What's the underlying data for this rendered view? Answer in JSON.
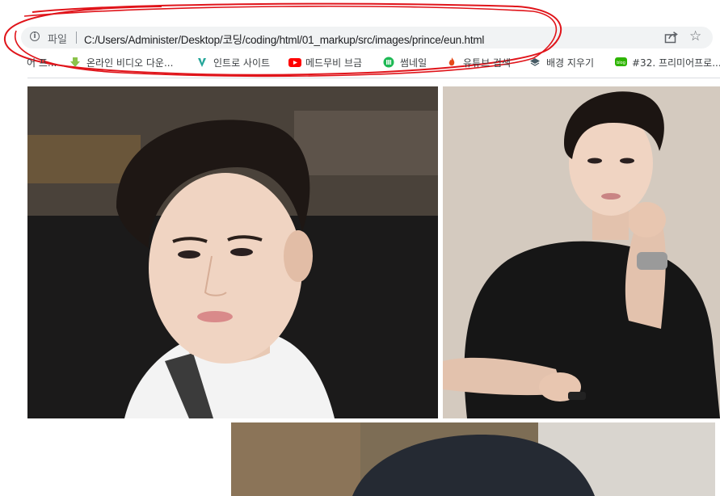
{
  "omnibox": {
    "scheme_label": "파일",
    "url": "C:/Users/Administer/Desktop/코딩/coding/html/01_markup/src/images/prince/eun.html",
    "info_icon": "info-icon",
    "share_icon": "share-icon",
    "star_icon": "star-icon"
  },
  "bookmarks": {
    "items": [
      {
        "label": "어 프...",
        "icon": "none"
      },
      {
        "label": "온라인 비디오 다운...",
        "icon": "download-arrow-icon"
      },
      {
        "label": "인트로 사이트",
        "icon": "v-logo-icon"
      },
      {
        "label": "메드무비 브금",
        "icon": "youtube-icon"
      },
      {
        "label": "썸네일",
        "icon": "green-circle-icon"
      },
      {
        "label": "유튜브 검색",
        "icon": "flame-icon"
      },
      {
        "label": "배경 지우기",
        "icon": "layers-icon"
      },
      {
        "label": "#32. 프리미어프로...",
        "icon": "blog-icon"
      }
    ]
  },
  "page": {
    "images": [
      {
        "name": "portrait-closeup",
        "description_icon": "photo"
      },
      {
        "name": "portrait-black-tshirt",
        "description_icon": "photo"
      },
      {
        "name": "portrait-partial",
        "description_icon": "photo"
      }
    ]
  },
  "colors": {
    "annotation_red": "#e0141a",
    "omnibox_bg": "#f1f3f4",
    "text": "#202124"
  }
}
